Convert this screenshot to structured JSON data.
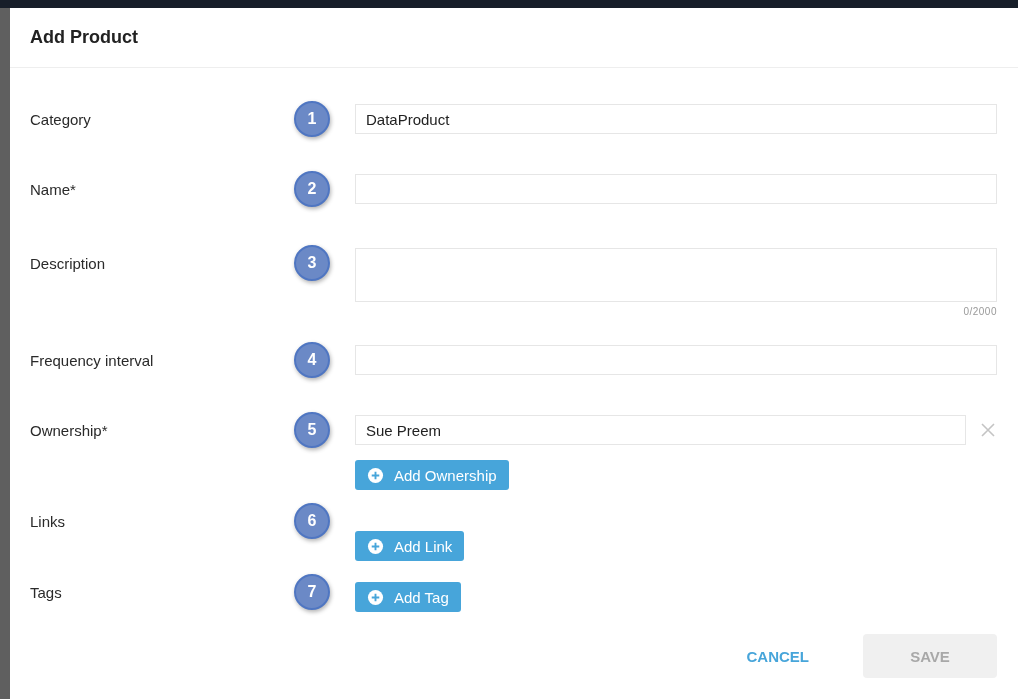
{
  "dialog": {
    "title": "Add Product"
  },
  "fields": [
    {
      "label": "Category",
      "step": "1",
      "kind": "input",
      "value": "DataProduct"
    },
    {
      "label": "Name*",
      "step": "2",
      "kind": "input"
    },
    {
      "label": "Description",
      "step": "3",
      "kind": "textarea",
      "counter": "0/2000"
    },
    {
      "label": "Frequency interval",
      "step": "4",
      "kind": "input"
    },
    {
      "label": "Ownership*",
      "step": "5",
      "kind": "list",
      "entries": [
        "Sue Preem"
      ],
      "add_button": "Add Ownership"
    },
    {
      "label": "Links",
      "step": "6",
      "kind": "list",
      "add_button": "Add Link"
    },
    {
      "label": "Tags",
      "step": "7",
      "kind": "list",
      "add_button": "Add Tag"
    }
  ],
  "actions": {
    "cancel": "CANCEL",
    "save": "SAVE",
    "save_disabled": true
  }
}
